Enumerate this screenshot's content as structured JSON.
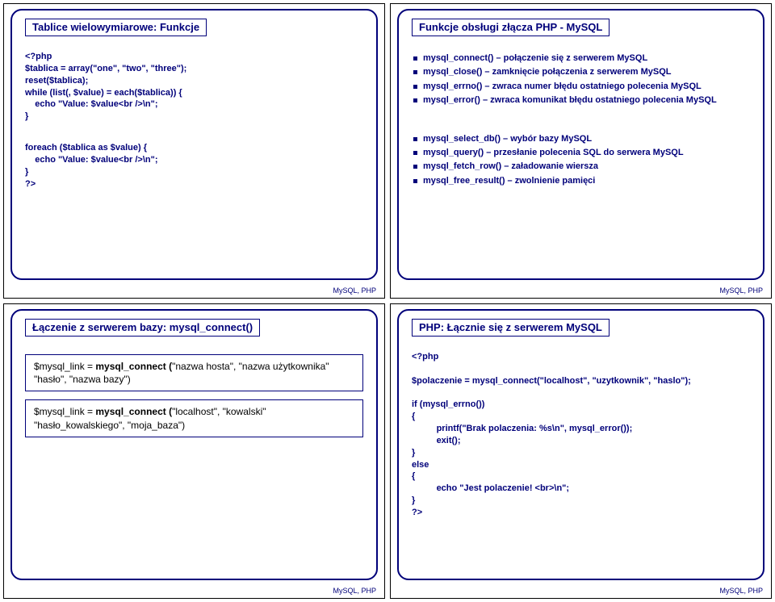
{
  "footer": "MySQL, PHP",
  "slide1": {
    "title": "Tablice wielowymiarowe: Funkcje",
    "code1": "<?php\n$tablica = array(\"one\", \"two\", \"three\");\nreset($tablica);\nwhile (list(, $value) = each($tablica)) {\n    echo \"Value: $value<br />\\n\";\n}",
    "code2": "foreach ($tablica as $value) {\n    echo \"Value: $value<br />\\n\";\n}\n?>"
  },
  "slide2": {
    "title": "Funkcje obsługi złącza PHP - MySQL",
    "groupA": [
      "mysql_connect() – połączenie się z serwerem MySQL",
      "mysql_close() – zamknięcie połączenia z serwerem MySQL",
      "mysql_errno() – zwraca numer błędu ostatniego polecenia MySQL",
      "mysql_error() – zwraca komunikat błędu ostatniego polecenia MySQL"
    ],
    "groupB": [
      "mysql_select_db() – wybór bazy MySQL",
      "mysql_query() – przesłanie polecenia SQL do serwera MySQL",
      "mysql_fetch_row() – załadowanie wiersza",
      "mysql_free_result() – zwolnienie pamięci"
    ]
  },
  "slide3": {
    "title": "Łączenie z serwerem bazy: mysql_connect()",
    "box1_pre": "$mysql_link = ",
    "box1_bold": "mysql_connect (",
    "box1_rest": "\"nazwa hosta\", \"nazwa użytkownika\" \"hasło\", \"nazwa bazy\")",
    "box2_pre": "$mysql_link = ",
    "box2_bold": "mysql_connect (",
    "box2_rest": "\"localhost\", \"kowalski\" \"hasło_kowalskiego\", \"moja_baza\")"
  },
  "slide4": {
    "title": "PHP: Łącznie się z serwerem MySQL",
    "code": "<?php\n\n$polaczenie = mysql_connect(\"localhost\", \"uzytkownik\", \"haslo\");\n\nif (mysql_errno())\n{\n          printf(\"Brak polaczenia: %s\\n\", mysql_error());\n          exit();\n}\nelse\n{\n          echo \"Jest polaczenie! <br>\\n\";\n}\n?>"
  }
}
